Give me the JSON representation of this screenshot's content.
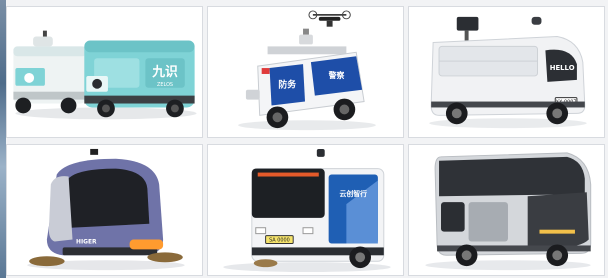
{
  "tiles": [
    {
      "brand_text": "九识",
      "sub_text": "ZELOS",
      "accent": "#7fd3d6"
    },
    {
      "brand_text": "防务",
      "sub_text": "警察",
      "accent": "#1e4ea8"
    },
    {
      "brand_text": "HELLO",
      "plate": "XX 0007",
      "accent": "#e9ebee"
    },
    {
      "brand_text": "HIGER",
      "accent": "#6f73a8"
    },
    {
      "brand_text": "云创智行",
      "plate": "SA 0000",
      "accent": "#1f5fb4"
    },
    {
      "brand_text": "",
      "accent": "#cfd3d8"
    }
  ]
}
